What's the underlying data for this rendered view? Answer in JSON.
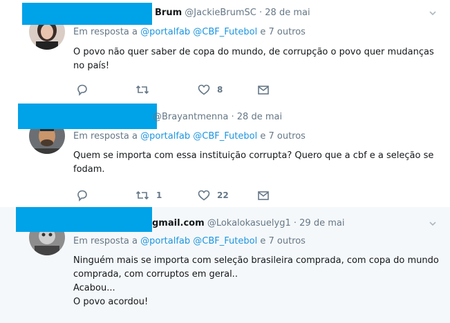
{
  "tweets": [
    {
      "name": "Brum",
      "handle": "@JackieBrumSC",
      "dot": "·",
      "date": "28 de mai",
      "reply_prefix": "Em resposta a",
      "reply_users": [
        "@portalfab",
        "@CBF_Futebol"
      ],
      "reply_suffix": "e 7 outros",
      "text_lines": [
        "O povo não quer saber de copa do mundo, de corrupção o povo quer mudanças no país!"
      ],
      "retweets": "",
      "likes": "8"
    },
    {
      "name": "",
      "handle": "@Brayantmenna",
      "dot": "·",
      "date": "28 de mai",
      "reply_prefix": "Em resposta a",
      "reply_users": [
        "@portalfab",
        "@CBF_Futebol"
      ],
      "reply_suffix": "e 7 outros",
      "text_lines": [
        "Quem se importa com essa instituição corrupta? Quero que a cbf e a seleção se fodam."
      ],
      "retweets": "1",
      "likes": "22"
    },
    {
      "name": "gmail.com",
      "handle": "@Lokalokasuelyg1",
      "dot": "·",
      "date": "29 de mai",
      "reply_prefix": "Em resposta a",
      "reply_users": [
        "@portalfab",
        "@CBF_Futebol"
      ],
      "reply_suffix": "e 7 outros",
      "text_lines": [
        "Ninguém mais se importa com seleção brasileira comprada, com copa do mundo comprada, com corruptos em geral..",
        "Acabou...",
        "O povo acordou!"
      ],
      "retweets": "",
      "likes": ""
    }
  ],
  "icons": [
    "reply-icon",
    "retweet-icon",
    "like-icon",
    "message-icon",
    "caret-down-icon"
  ],
  "colors": {
    "redaction": "#00a2e8",
    "link": "#1b95e0",
    "muted": "#657786",
    "selected_bg": "#f5f8fa"
  }
}
